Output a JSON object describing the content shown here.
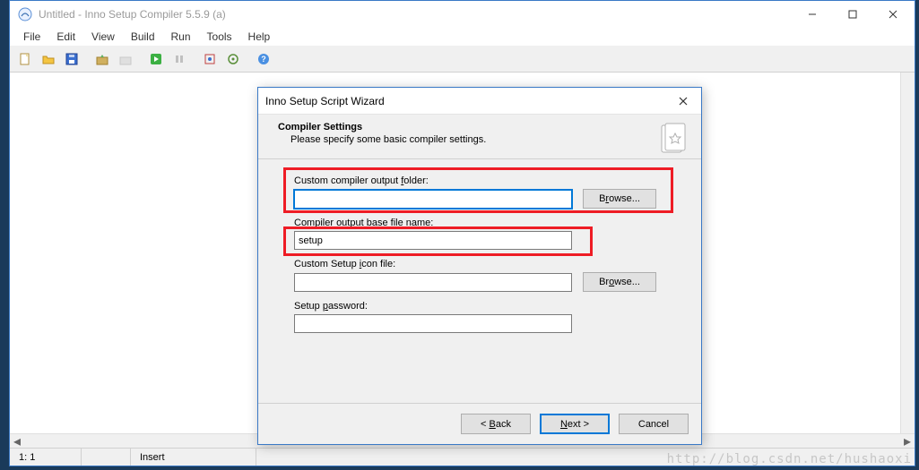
{
  "window": {
    "title": "Untitled - Inno Setup Compiler 5.5.9 (a)"
  },
  "menu": [
    "File",
    "Edit",
    "View",
    "Build",
    "Run",
    "Tools",
    "Help"
  ],
  "statusbar": {
    "position": "1:   1",
    "mode": "Insert"
  },
  "dialog": {
    "title": "Inno Setup Script Wizard",
    "header_title": "Compiler Settings",
    "header_subtitle": "Please specify some basic compiler settings.",
    "fields": {
      "output_folder_label": "Custom compiler output folder:",
      "output_folder_value": "",
      "browse1": "Browse...",
      "base_filename_label": "Compiler output base file name:",
      "base_filename_value": "setup",
      "icon_file_label": "Custom Setup icon file:",
      "icon_file_value": "",
      "browse2": "Browse...",
      "password_label": "Setup password:",
      "password_value": ""
    },
    "buttons": {
      "back": "< Back",
      "next": "Next >",
      "cancel": "Cancel"
    }
  },
  "watermark": "http://blog.csdn.net/hushaoxi"
}
